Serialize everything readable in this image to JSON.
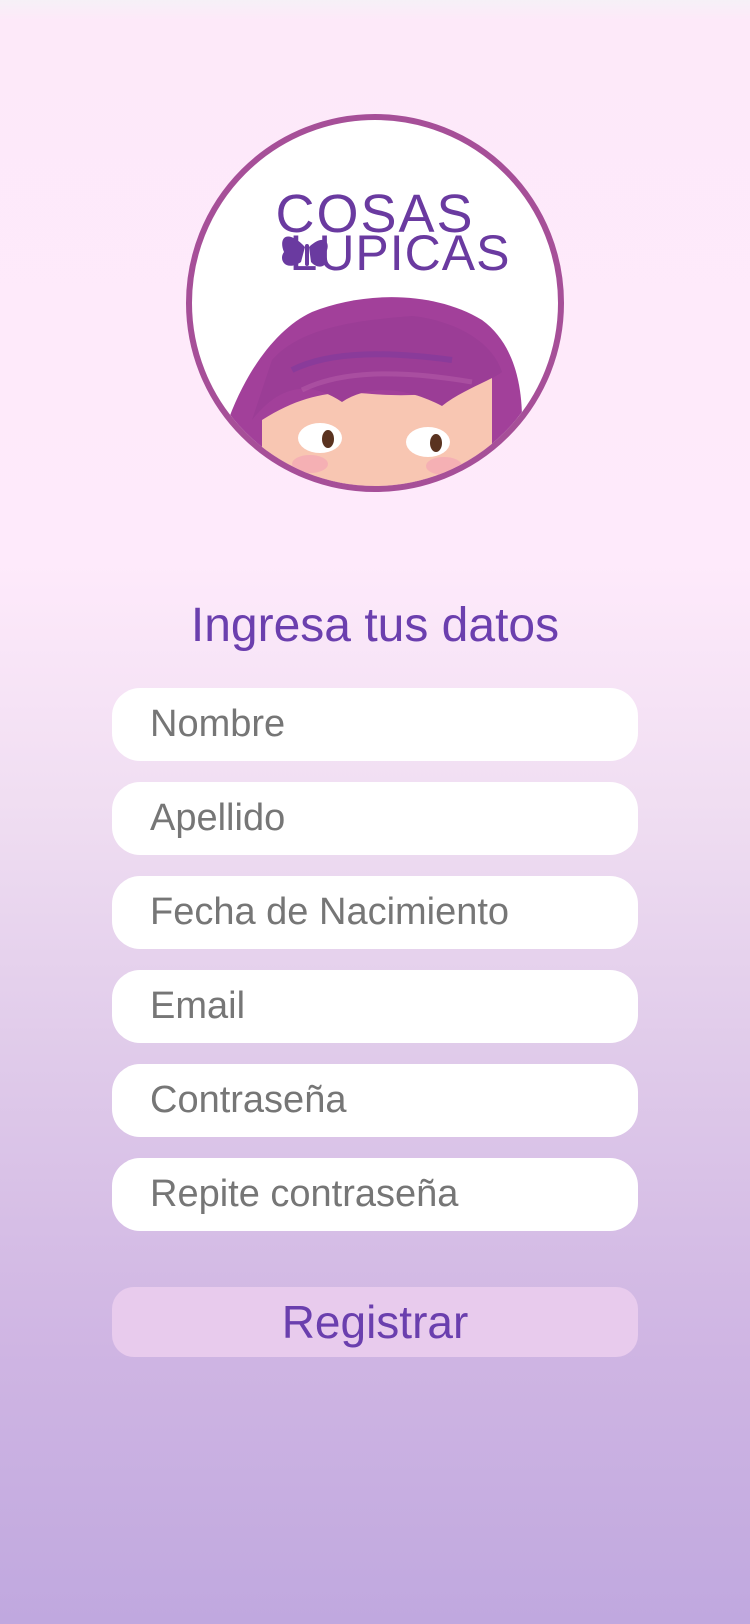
{
  "logo": {
    "line1": "COSAS",
    "line2": "LUPICAS",
    "icon": "butterfly-icon"
  },
  "form": {
    "title": "Ingresa tus datos",
    "fields": [
      {
        "placeholder": "Nombre"
      },
      {
        "placeholder": "Apellido"
      },
      {
        "placeholder": "Fecha de Nacimiento"
      },
      {
        "placeholder": "Email"
      },
      {
        "placeholder": "Contraseña"
      },
      {
        "placeholder": "Repite contraseña"
      }
    ],
    "submit_label": "Registrar"
  },
  "colors": {
    "accent": "#6b3fae",
    "logo_border": "#a64f98",
    "hair": "#a2409a",
    "button_bg": "#e8cbed"
  }
}
